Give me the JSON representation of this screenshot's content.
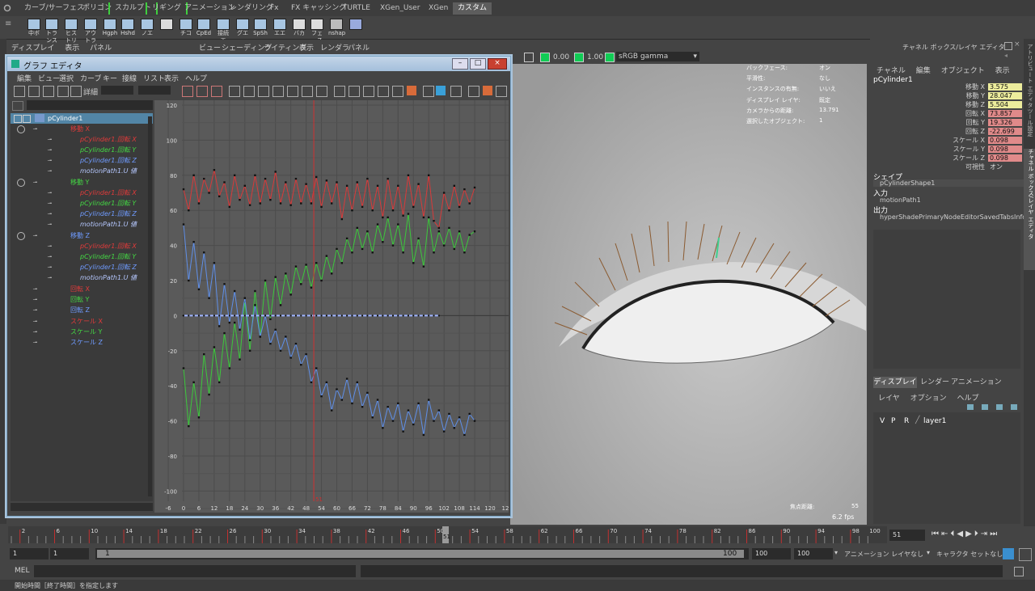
{
  "shelf_tabs": [
    "カーブ/サーフェス",
    "ポリゴン",
    "スカルプト",
    "リギング",
    "アニメーション",
    "レンダリング",
    "Fx",
    "FX キャッシング",
    "TURTLE",
    "XGen_User",
    "XGen",
    "カスタム"
  ],
  "shelf_buttons": [
    "中ボ",
    "トランス",
    "ヒストリ",
    "アウトラ",
    "Hgph",
    "Hshd",
    "ノエ",
    "",
    "チコ",
    "CpEd",
    "接続エ",
    "グエ",
    "SpSh",
    "エエ",
    "バカ",
    "フェース",
    "nshap",
    ""
  ],
  "viewport": {
    "panel_menu": [
      "ディスプレイ",
      "表示",
      "パネル"
    ],
    "menu": [
      "ビュー",
      "シェーディング",
      "ライティング",
      "表示",
      "レンダラ",
      "パネル"
    ],
    "exposure": "0.00",
    "gamma": "1.00",
    "color_space": "sRGB gamma",
    "hud": [
      {
        "label": "バックフェース:",
        "value": "オン"
      },
      {
        "label": "平滑性:",
        "value": "なし"
      },
      {
        "label": "インスタンスの有無:",
        "value": "いいえ"
      },
      {
        "label": "ディスプレイ レイヤ:",
        "value": "既定"
      },
      {
        "label": "カメラからの距離:",
        "value": "13.791"
      },
      {
        "label": "選択したオブジェクト:",
        "value": "1"
      }
    ],
    "focal_label": "焦点距離:",
    "focal_value": "55",
    "fps": "6.2 fps"
  },
  "graph_editor": {
    "title": "グラフ エディタ",
    "menu": [
      "編集",
      "ビュー",
      "選択",
      "カーブ",
      "キー",
      "接線",
      "リスト",
      "表示",
      "ヘルプ"
    ],
    "detail_label": "詳細",
    "outliner": [
      {
        "text": "pCylinder1",
        "color": "#ffffff",
        "indent": 0,
        "kind": "root"
      },
      {
        "text": "移動 X",
        "color": "#e03a3a",
        "indent": 1,
        "kind": "attr"
      },
      {
        "text": "pCylinder1.回転 X",
        "color": "#e03a3a",
        "indent": 2,
        "kind": "sub"
      },
      {
        "text": "pCylinder1.回転 Y",
        "color": "#44d844",
        "indent": 2,
        "kind": "sub"
      },
      {
        "text": "pCylinder1.回転 Z",
        "color": "#6f9bff",
        "indent": 2,
        "kind": "sub"
      },
      {
        "text": "motionPath1.U 値",
        "color": "#b6c8ff",
        "indent": 2,
        "kind": "sub"
      },
      {
        "text": "移動 Y",
        "color": "#44d844",
        "indent": 1,
        "kind": "attr"
      },
      {
        "text": "pCylinder1.回転 X",
        "color": "#e03a3a",
        "indent": 2,
        "kind": "sub"
      },
      {
        "text": "pCylinder1.回転 Y",
        "color": "#44d844",
        "indent": 2,
        "kind": "sub"
      },
      {
        "text": "pCylinder1.回転 Z",
        "color": "#6f9bff",
        "indent": 2,
        "kind": "sub"
      },
      {
        "text": "motionPath1.U 値",
        "color": "#b6c8ff",
        "indent": 2,
        "kind": "sub"
      },
      {
        "text": "移動 Z",
        "color": "#6f9bff",
        "indent": 1,
        "kind": "attr"
      },
      {
        "text": "pCylinder1.回転 X",
        "color": "#e03a3a",
        "indent": 2,
        "kind": "sub"
      },
      {
        "text": "pCylinder1.回転 Y",
        "color": "#44d844",
        "indent": 2,
        "kind": "sub"
      },
      {
        "text": "pCylinder1.回転 Z",
        "color": "#6f9bff",
        "indent": 2,
        "kind": "sub"
      },
      {
        "text": "motionPath1.U 値",
        "color": "#b6c8ff",
        "indent": 2,
        "kind": "sub"
      },
      {
        "text": "回転 X",
        "color": "#e03a3a",
        "indent": 1,
        "kind": "leaf"
      },
      {
        "text": "回転 Y",
        "color": "#44d844",
        "indent": 1,
        "kind": "leaf"
      },
      {
        "text": "回転 Z",
        "color": "#6f9bff",
        "indent": 1,
        "kind": "leaf"
      },
      {
        "text": "スケール X",
        "color": "#e03a3a",
        "indent": 1,
        "kind": "leaf"
      },
      {
        "text": "スケール Y",
        "color": "#44d844",
        "indent": 1,
        "kind": "leaf"
      },
      {
        "text": "スケール Z",
        "color": "#6f9bff",
        "indent": 1,
        "kind": "leaf"
      }
    ],
    "y_ticks": [
      "120",
      "100",
      "80",
      "60",
      "40",
      "20",
      "0",
      "-20",
      "-40",
      "-60",
      "-80",
      "-100"
    ],
    "x_ticks": [
      "-6",
      "0",
      "6",
      "12",
      "18",
      "24",
      "30",
      "36",
      "42",
      "48",
      "54",
      "60",
      "66",
      "72",
      "78",
      "84",
      "90",
      "96",
      "102",
      "108",
      "114",
      "120",
      "12"
    ],
    "current_frame": "51",
    "curves": {
      "red": [
        [
          0,
          72
        ],
        [
          2,
          60
        ],
        [
          4,
          80
        ],
        [
          6,
          64
        ],
        [
          8,
          78
        ],
        [
          10,
          70
        ],
        [
          12,
          83
        ],
        [
          14,
          68
        ],
        [
          16,
          76
        ],
        [
          18,
          62
        ],
        [
          20,
          80
        ],
        [
          22,
          66
        ],
        [
          24,
          74
        ],
        [
          26,
          63
        ],
        [
          28,
          80
        ],
        [
          30,
          64
        ],
        [
          32,
          78
        ],
        [
          34,
          66
        ],
        [
          36,
          82
        ],
        [
          38,
          64
        ],
        [
          40,
          76
        ],
        [
          42,
          63
        ],
        [
          44,
          78
        ],
        [
          46,
          64
        ],
        [
          48,
          75
        ],
        [
          50,
          64
        ],
        [
          52,
          79
        ],
        [
          54,
          62
        ],
        [
          56,
          77
        ],
        [
          58,
          64
        ],
        [
          60,
          76
        ],
        [
          62,
          55
        ],
        [
          64,
          74
        ],
        [
          66,
          60
        ],
        [
          68,
          76
        ],
        [
          70,
          62
        ],
        [
          72,
          78
        ],
        [
          74,
          60
        ],
        [
          76,
          74
        ],
        [
          78,
          56
        ],
        [
          80,
          78
        ],
        [
          82,
          60
        ],
        [
          84,
          74
        ],
        [
          86,
          57
        ],
        [
          88,
          80
        ],
        [
          90,
          62
        ],
        [
          92,
          75
        ],
        [
          94,
          56
        ],
        [
          96,
          80
        ],
        [
          98,
          54
        ],
        [
          100,
          50
        ],
        [
          102,
          70
        ],
        [
          104,
          60
        ],
        [
          106,
          74
        ],
        [
          108,
          62
        ],
        [
          110,
          72
        ],
        [
          112,
          64
        ],
        [
          114,
          73
        ]
      ],
      "green": [
        [
          0,
          -30
        ],
        [
          2,
          -63
        ],
        [
          4,
          -38
        ],
        [
          6,
          -58
        ],
        [
          8,
          -22
        ],
        [
          10,
          -45
        ],
        [
          12,
          -18
        ],
        [
          14,
          -38
        ],
        [
          16,
          -10
        ],
        [
          18,
          -30
        ],
        [
          20,
          -4
        ],
        [
          22,
          -25
        ],
        [
          24,
          8
        ],
        [
          26,
          -20
        ],
        [
          28,
          14
        ],
        [
          30,
          -12
        ],
        [
          32,
          20
        ],
        [
          34,
          -2
        ],
        [
          36,
          22
        ],
        [
          38,
          6
        ],
        [
          40,
          24
        ],
        [
          42,
          12
        ],
        [
          44,
          28
        ],
        [
          46,
          18
        ],
        [
          48,
          29
        ],
        [
          50,
          16
        ],
        [
          52,
          30
        ],
        [
          54,
          20
        ],
        [
          56,
          34
        ],
        [
          58,
          24
        ],
        [
          60,
          38
        ],
        [
          62,
          30
        ],
        [
          64,
          44
        ],
        [
          66,
          36
        ],
        [
          68,
          50
        ],
        [
          70,
          38
        ],
        [
          72,
          48
        ],
        [
          74,
          36
        ],
        [
          76,
          52
        ],
        [
          78,
          42
        ],
        [
          80,
          56
        ],
        [
          82,
          40
        ],
        [
          84,
          52
        ],
        [
          86,
          36
        ],
        [
          88,
          58
        ],
        [
          90,
          30
        ],
        [
          92,
          44
        ],
        [
          94,
          28
        ],
        [
          96,
          56
        ],
        [
          98,
          36
        ],
        [
          100,
          48
        ],
        [
          102,
          40
        ],
        [
          104,
          50
        ],
        [
          106,
          38
        ],
        [
          108,
          48
        ],
        [
          110,
          36
        ],
        [
          112,
          46
        ],
        [
          114,
          48
        ]
      ],
      "blue": [
        [
          0,
          52
        ],
        [
          2,
          20
        ],
        [
          4,
          42
        ],
        [
          6,
          15
        ],
        [
          8,
          36
        ],
        [
          10,
          10
        ],
        [
          12,
          30
        ],
        [
          14,
          -6
        ],
        [
          16,
          18
        ],
        [
          18,
          -4
        ],
        [
          20,
          14
        ],
        [
          22,
          -8
        ],
        [
          24,
          10
        ],
        [
          26,
          -14
        ],
        [
          28,
          6
        ],
        [
          30,
          -12
        ],
        [
          32,
          0
        ],
        [
          34,
          -16
        ],
        [
          36,
          -8
        ],
        [
          38,
          -20
        ],
        [
          40,
          -12
        ],
        [
          42,
          -24
        ],
        [
          44,
          -16
        ],
        [
          46,
          -28
        ],
        [
          48,
          -22
        ],
        [
          50,
          -38
        ],
        [
          52,
          -30
        ],
        [
          54,
          -46
        ],
        [
          56,
          -38
        ],
        [
          58,
          -54
        ],
        [
          60,
          -42
        ],
        [
          62,
          -48
        ],
        [
          64,
          -36
        ],
        [
          66,
          -50
        ],
        [
          68,
          -38
        ],
        [
          70,
          -52
        ],
        [
          72,
          -44
        ],
        [
          74,
          -58
        ],
        [
          76,
          -48
        ],
        [
          78,
          -64
        ],
        [
          80,
          -52
        ],
        [
          82,
          -60
        ],
        [
          84,
          -50
        ],
        [
          86,
          -66
        ],
        [
          88,
          -54
        ],
        [
          90,
          -62
        ],
        [
          92,
          -50
        ],
        [
          94,
          -68
        ],
        [
          96,
          -48
        ],
        [
          98,
          -60
        ],
        [
          100,
          -54
        ],
        [
          102,
          -66
        ],
        [
          104,
          -56
        ],
        [
          106,
          -64
        ],
        [
          108,
          -58
        ],
        [
          110,
          -68
        ],
        [
          112,
          -56
        ],
        [
          114,
          -60
        ]
      ]
    }
  },
  "channel_box": {
    "title": "チャネル ボックス/レイヤ エディタ",
    "menu": [
      "チャネル",
      "編集",
      "オブジェクト",
      "表示"
    ],
    "object": "pCylinder1",
    "channels": [
      {
        "label": "移動 X",
        "value": "3.575",
        "color": "#ecec9c"
      },
      {
        "label": "移動 Y",
        "value": "28.047",
        "color": "#ecec9c"
      },
      {
        "label": "移動 Z",
        "value": "5.504",
        "color": "#ecec9c"
      },
      {
        "label": "回転 X",
        "value": "73.857",
        "color": "#e08a8a"
      },
      {
        "label": "回転 Y",
        "value": "19.326",
        "color": "#e08a8a"
      },
      {
        "label": "回転 Z",
        "value": "-22.699",
        "color": "#e08a8a"
      },
      {
        "label": "スケール X",
        "value": "0.098",
        "color": "#e08a8a"
      },
      {
        "label": "スケール Y",
        "value": "0.098",
        "color": "#e08a8a"
      },
      {
        "label": "スケール Z",
        "value": "0.098",
        "color": "#e08a8a"
      },
      {
        "label": "可視性",
        "value": "オン",
        "color": "#444444"
      }
    ],
    "shapes_label": "シェイプ",
    "shape": "pCylinderShape1",
    "inputs_label": "入力",
    "input": "motionPath1",
    "outputs_label": "出力",
    "output": "hyperShadePrimaryNodeEditorSavedTabsInfo",
    "layer_tabs": [
      "ディスプレイ",
      "レンダー",
      "アニメーション"
    ],
    "layer_menu": [
      "レイヤ",
      "オプション",
      "ヘルプ"
    ],
    "layer": {
      "v": "V",
      "p": "P",
      "r": "R",
      "name": "layer1"
    },
    "side_tabs": [
      "アトリビュート エディタ",
      "ツール設定",
      "チャネル ボックス/レイヤ エディタ"
    ]
  },
  "timeslider": {
    "ticks": [
      "2",
      "6",
      "10",
      "14",
      "18",
      "22",
      "26",
      "30",
      "34",
      "38",
      "42",
      "46",
      "50",
      "54",
      "58",
      "62",
      "66",
      "70",
      "74",
      "78",
      "82",
      "86",
      "90",
      "94",
      "98",
      "100"
    ],
    "current": "51",
    "current_field": "51"
  },
  "range": {
    "start": "1",
    "anim_start": "1",
    "slider_start": "1",
    "slider_end": "100",
    "end": "100",
    "anim_end": "100",
    "anim_layer": "アニメーション レイヤなし",
    "char_set": "キャラクタ セットなし"
  },
  "mel_label": "MEL",
  "help_text": "開始時間［終了時間］を指定します"
}
